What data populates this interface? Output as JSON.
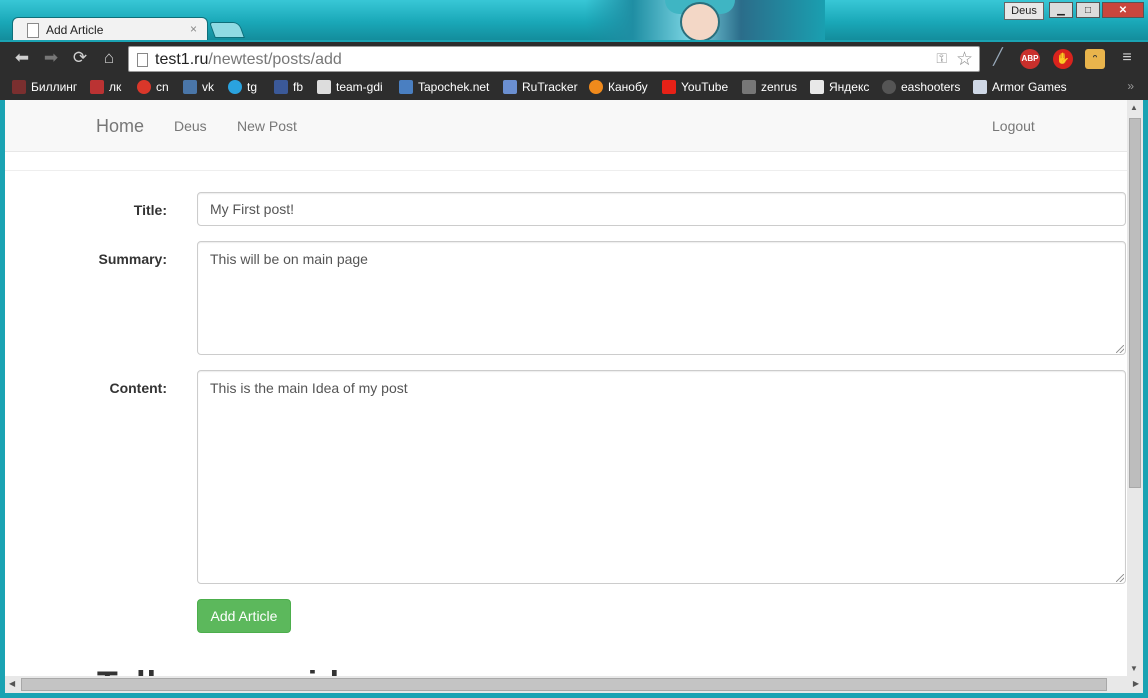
{
  "window": {
    "tab_title": "Add Article",
    "tab_close": "×",
    "user_badge": "Deus",
    "minimize": "▁",
    "maximize": "□",
    "close": "✕"
  },
  "toolbar": {
    "url_host": "test1.ru",
    "url_path": "/newtest/posts/add",
    "extensions": [
      {
        "name": "ABP",
        "color": "#c9302c"
      },
      {
        "name": "",
        "color": "#d9231d"
      }
    ]
  },
  "bookmarks": [
    {
      "label": "Биллинг",
      "icon": "billing-icon",
      "color": "#7a2f2f"
    },
    {
      "label": "лк",
      "icon": "lk-icon",
      "color": "#b33"
    },
    {
      "label": "cn",
      "icon": "cn-icon",
      "color": "#d9372a"
    },
    {
      "label": "vk",
      "icon": "vk-icon",
      "color": "#4a76a8"
    },
    {
      "label": "tg",
      "icon": "telegram-icon",
      "color": "#2aa3df"
    },
    {
      "label": "fb",
      "icon": "facebook-icon",
      "color": "#3b5998"
    },
    {
      "label": "team-gdi",
      "icon": "team-gdi-icon",
      "color": "#ddd"
    },
    {
      "label": "Tapochek.net",
      "icon": "tapochek-icon",
      "color": "#4a7fc1"
    },
    {
      "label": "RuTracker",
      "icon": "rutracker-icon",
      "color": "#6b8fd0"
    },
    {
      "label": "Канобу",
      "icon": "kanobu-icon",
      "color": "#f08a1c"
    },
    {
      "label": "YouTube",
      "icon": "youtube-icon",
      "color": "#e62117"
    },
    {
      "label": "zenrus",
      "icon": "zenrus-icon",
      "color": "#777"
    },
    {
      "label": "Яндекс",
      "icon": "yandex-icon",
      "color": "#e8e8e8"
    },
    {
      "label": "eashooters",
      "icon": "eashooters-icon",
      "color": "#555"
    },
    {
      "label": "Armor Games",
      "icon": "armor-games-icon",
      "color": "#cfd8e6"
    }
  ],
  "bookmarks_more": "»",
  "navbar": {
    "brand": "Home",
    "links": [
      "Deus",
      "New Post"
    ],
    "logout": "Logout"
  },
  "form": {
    "title_label": "Title:",
    "title_value": "My First post!",
    "summary_label": "Summary:",
    "summary_value": "This will be on main page",
    "content_label": "Content:",
    "content_value": "This is the main Idea of my post",
    "submit_label": "Add Article"
  },
  "cut_heading": "Tell us your ideas",
  "colors": {
    "accent_success": "#5cb85c",
    "titlebar": "#1aa3b3"
  }
}
